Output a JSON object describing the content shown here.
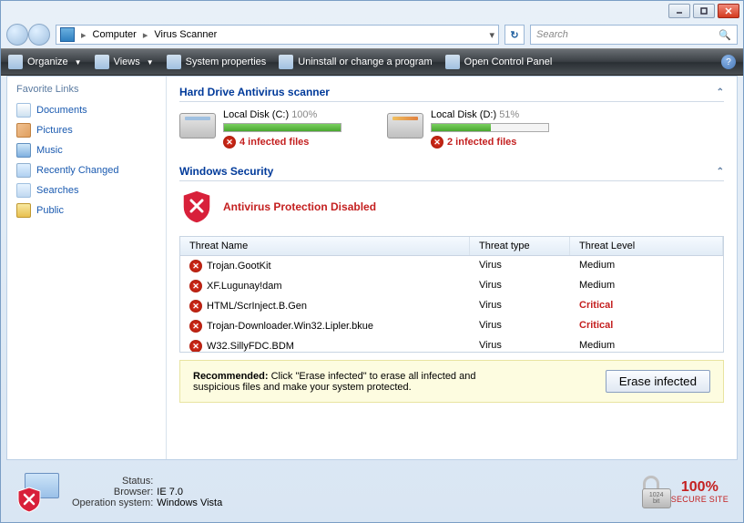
{
  "breadcrumb": {
    "root": "Computer",
    "page": "Virus Scanner"
  },
  "search": {
    "placeholder": "Search"
  },
  "toolbar": {
    "organize": "Organize",
    "views": "Views",
    "sysprops": "System properties",
    "uninstall": "Uninstall or change a program",
    "controlpanel": "Open Control Panel"
  },
  "sidebar": {
    "header": "Favorite Links",
    "items": [
      {
        "label": "Documents",
        "icon": "ic-doc"
      },
      {
        "label": "Pictures",
        "icon": "ic-pic"
      },
      {
        "label": "Music",
        "icon": "ic-mus"
      },
      {
        "label": "Recently Changed",
        "icon": "ic-rec"
      },
      {
        "label": "Searches",
        "icon": "ic-sea"
      },
      {
        "label": "Public",
        "icon": "ic-pub"
      }
    ]
  },
  "scanner": {
    "title": "Hard Drive Antivirus scanner",
    "drives": [
      {
        "label": "Local Disk (C:)",
        "percent": 100,
        "percent_text": "100%",
        "infected_text": "4 infected files"
      },
      {
        "label": "Local Disk (D:)",
        "percent": 51,
        "percent_text": "51%",
        "infected_text": "2 infected files"
      }
    ]
  },
  "security": {
    "title": "Windows Security",
    "disabled_text": "Antivirus Protection Disabled",
    "columns": {
      "name": "Threat Name",
      "type": "Threat type",
      "level": "Threat Level"
    },
    "threats": [
      {
        "name": "Trojan.GootKit",
        "type": "Virus",
        "level": "Medium",
        "critical": false
      },
      {
        "name": "XF.Lugunay!dam",
        "type": "Virus",
        "level": "Medium",
        "critical": false
      },
      {
        "name": "HTML/ScrInject.B.Gen",
        "type": "Virus",
        "level": "Critical",
        "critical": true
      },
      {
        "name": "Trojan-Downloader.Win32.Lipler.bkue",
        "type": "Virus",
        "level": "Critical",
        "critical": true
      },
      {
        "name": "W32.SillyFDC.BDM",
        "type": "Virus",
        "level": "Medium",
        "critical": false
      }
    ],
    "recommend_label": "Recommended:",
    "recommend_text": " Click \"Erase infected\" to erase all infected and suspicious files and make your system protected.",
    "erase_button": "Erase infected"
  },
  "footer": {
    "status_label": "Status:",
    "browser_label": "Browser:",
    "browser_value": "IE 7.0",
    "os_label": "Operation system:",
    "os_value": "Windows Vista",
    "lock_bits": "1024",
    "lock_bit_label": "bit",
    "secure_percent": "100%",
    "secure_label": "SECURE SITE"
  }
}
